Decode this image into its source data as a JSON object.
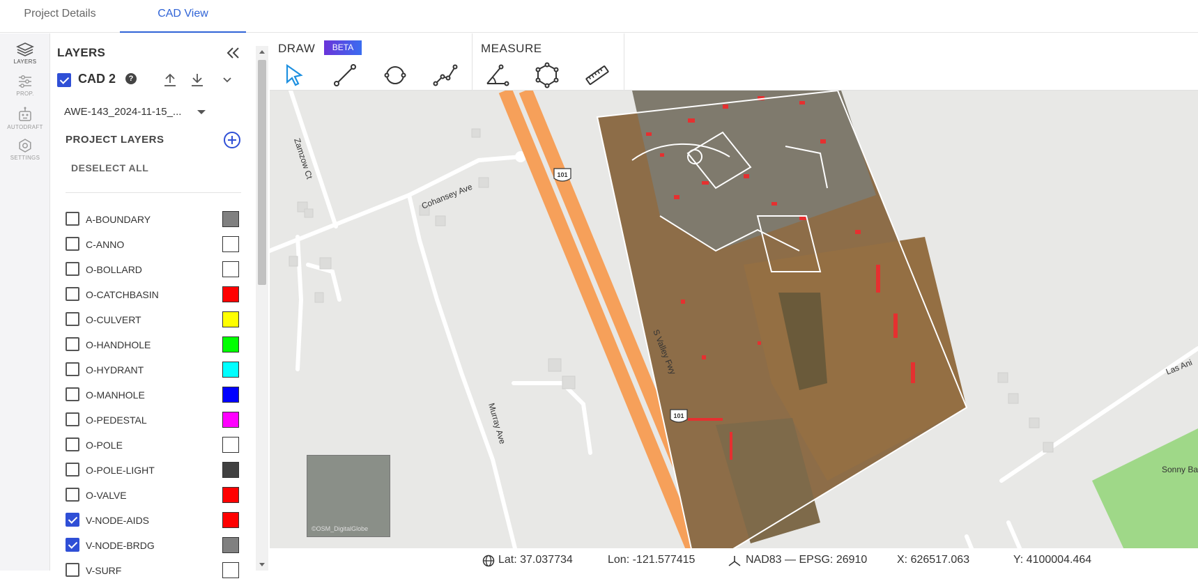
{
  "tabs": [
    {
      "label": "Project Details",
      "active": false
    },
    {
      "label": "CAD View",
      "active": true
    }
  ],
  "rail": [
    {
      "label": "LAYERS",
      "icon": "layers-icon",
      "active": true
    },
    {
      "label": "PROP.",
      "icon": "sliders-icon",
      "active": false
    },
    {
      "label": "AUTODRAFT",
      "icon": "robot-icon",
      "active": false
    },
    {
      "label": "SETTINGS",
      "icon": "gear-icon",
      "active": false
    }
  ],
  "panel": {
    "title": "LAYERS",
    "cad_label": "CAD 2",
    "help": "?",
    "file_select": "AWE-143_2024-11-15_...",
    "section_title": "PROJECT LAYERS",
    "deselect_label": "DESELECT ALL"
  },
  "layers": [
    {
      "name": "A-BOUNDARY",
      "checked": false,
      "color": "#808080"
    },
    {
      "name": "C-ANNO",
      "checked": false,
      "color": "#ffffff"
    },
    {
      "name": "O-BOLLARD",
      "checked": false,
      "color": "#ffffff"
    },
    {
      "name": "O-CATCHBASIN",
      "checked": false,
      "color": "#ff0000"
    },
    {
      "name": "O-CULVERT",
      "checked": false,
      "color": "#ffff00"
    },
    {
      "name": "O-HANDHOLE",
      "checked": false,
      "color": "#00ff00"
    },
    {
      "name": "O-HYDRANT",
      "checked": false,
      "color": "#00ffff"
    },
    {
      "name": "O-MANHOLE",
      "checked": false,
      "color": "#0000ff"
    },
    {
      "name": "O-PEDESTAL",
      "checked": false,
      "color": "#ff00ff"
    },
    {
      "name": "O-POLE",
      "checked": false,
      "color": "#ffffff"
    },
    {
      "name": "O-POLE-LIGHT",
      "checked": false,
      "color": "#404040"
    },
    {
      "name": "O-VALVE",
      "checked": false,
      "color": "#ff0000"
    },
    {
      "name": "V-NODE-AIDS",
      "checked": true,
      "color": "#ff0000"
    },
    {
      "name": "V-NODE-BRDG",
      "checked": true,
      "color": "#808080"
    },
    {
      "name": "V-SURF",
      "checked": false,
      "color": "#ffffff"
    }
  ],
  "toolbar": {
    "draw_title": "DRAW",
    "beta_label": "BETA",
    "measure_title": "MEASURE"
  },
  "map_labels": {
    "street1": "Zamzow Ct",
    "street2": "Cohansey Ave",
    "street3": "S Valley Fwy",
    "street4": "Murray Ave",
    "street5": "Las Ani",
    "park": "Sonny Bae",
    "shield": "101",
    "attribution": "©OSM_DigitalGlobe"
  },
  "status": {
    "lat": "Lat: 37.037734",
    "lon": "Lon: -121.577415",
    "crs": "NAD83 — EPSG: 26910",
    "x": "X: 626517.063",
    "y": "Y: 4100004.464"
  }
}
